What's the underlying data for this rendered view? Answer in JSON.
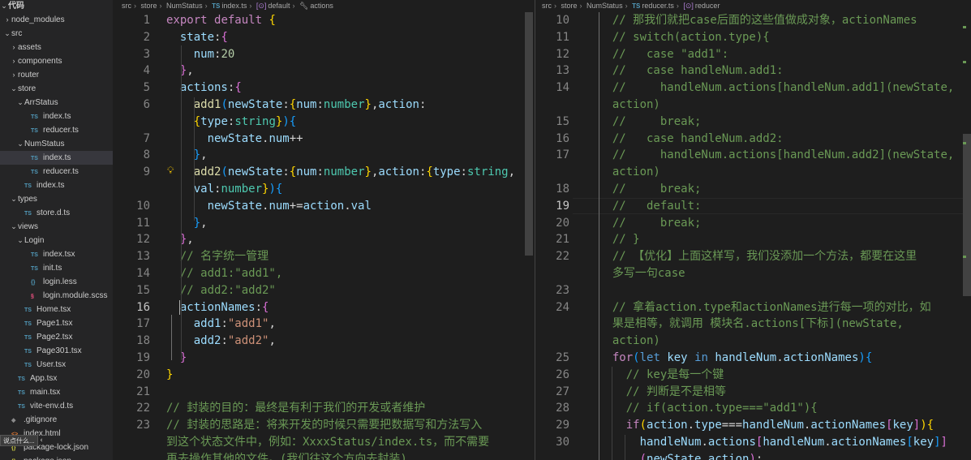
{
  "explorer": {
    "root": "代码",
    "items": [
      {
        "label": "node_modules",
        "icon": "",
        "chev": "›",
        "indent": 1
      },
      {
        "label": "src",
        "icon": "",
        "chev": "⌄",
        "indent": 1
      },
      {
        "label": "assets",
        "icon": "",
        "chev": "›",
        "indent": 2
      },
      {
        "label": "components",
        "icon": "",
        "chev": "›",
        "indent": 2
      },
      {
        "label": "router",
        "icon": "",
        "chev": "›",
        "indent": 2
      },
      {
        "label": "store",
        "icon": "",
        "chev": "⌄",
        "indent": 2
      },
      {
        "label": "ArrStatus",
        "icon": "",
        "chev": "⌄",
        "indent": 3
      },
      {
        "label": "index.ts",
        "icon": "TS",
        "chev": "",
        "indent": 4
      },
      {
        "label": "reducer.ts",
        "icon": "TS",
        "chev": "",
        "indent": 4
      },
      {
        "label": "NumStatus",
        "icon": "",
        "chev": "⌄",
        "indent": 3
      },
      {
        "label": "index.ts",
        "icon": "TS",
        "chev": "",
        "indent": 4
      },
      {
        "label": "reducer.ts",
        "icon": "TS",
        "chev": "",
        "indent": 4
      },
      {
        "label": "index.ts",
        "icon": "TS",
        "chev": "",
        "indent": 3
      },
      {
        "label": "types",
        "icon": "",
        "chev": "⌄",
        "indent": 2
      },
      {
        "label": "store.d.ts",
        "icon": "TS",
        "chev": "",
        "indent": 3
      },
      {
        "label": "views",
        "icon": "",
        "chev": "⌄",
        "indent": 2
      },
      {
        "label": "Login",
        "icon": "",
        "chev": "⌄",
        "indent": 3
      },
      {
        "label": "index.tsx",
        "icon": "TS",
        "chev": "",
        "indent": 4
      },
      {
        "label": "init.ts",
        "icon": "TS",
        "chev": "",
        "indent": 4
      },
      {
        "label": "login.less",
        "icon": "{}",
        "chev": "",
        "indent": 4
      },
      {
        "label": "login.module.scss",
        "icon": "§",
        "chev": "",
        "indent": 4
      },
      {
        "label": "Home.tsx",
        "icon": "TS",
        "chev": "",
        "indent": 3
      },
      {
        "label": "Page1.tsx",
        "icon": "TS",
        "chev": "",
        "indent": 3
      },
      {
        "label": "Page2.tsx",
        "icon": "TS",
        "chev": "",
        "indent": 3
      },
      {
        "label": "Page301.tsx",
        "icon": "TS",
        "chev": "",
        "indent": 3
      },
      {
        "label": "User.tsx",
        "icon": "TS",
        "chev": "",
        "indent": 3
      },
      {
        "label": "App.tsx",
        "icon": "TS",
        "chev": "",
        "indent": 2
      },
      {
        "label": "main.tsx",
        "icon": "TS",
        "chev": "",
        "indent": 2
      },
      {
        "label": "vite-env.d.ts",
        "icon": "TS",
        "chev": "",
        "indent": 2
      },
      {
        "label": ".gitignore",
        "icon": "◆",
        "chev": "",
        "indent": 1
      },
      {
        "label": "index.html",
        "icon": "<>",
        "chev": "",
        "indent": 1
      },
      {
        "label": "package-lock.json",
        "icon": "{}",
        "chev": "",
        "indent": 1
      },
      {
        "label": "package.json",
        "icon": "{}",
        "chev": "",
        "indent": 1
      }
    ],
    "tooltip": "说点什么..."
  },
  "left_editor": {
    "breadcrumb": {
      "parts": [
        "src",
        "store",
        "NumStatus"
      ],
      "file_badge": "TS",
      "file": "index.ts",
      "symbol1": "default",
      "symbol2": "actions"
    },
    "lines": [
      {
        "n": "1",
        "html": "<span class=\"kc\">export</span> <span class=\"kc\">default</span> <span class=\"br1\">{</span>"
      },
      {
        "n": "2",
        "html": "  <span class=\"p\">state</span><span class=\"d\">:</span><span class=\"br2\">{</span>"
      },
      {
        "n": "3",
        "html": "    <span class=\"p\">num</span><span class=\"d\">:</span><span class=\"n\">20</span>"
      },
      {
        "n": "4",
        "html": "  <span class=\"br2\">}</span><span class=\"d\">,</span>"
      },
      {
        "n": "5",
        "html": "  <span class=\"p\">actions</span><span class=\"d\">:</span><span class=\"br2\">{</span>"
      },
      {
        "n": "6",
        "html": "    <span class=\"f\">add1</span><span class=\"br3\">(</span><span class=\"p\">newState</span><span class=\"d\">:</span><span class=\"br1\">{</span><span class=\"p\">num</span><span class=\"d\">:</span><span class=\"t\">number</span><span class=\"br1\">}</span><span class=\"d\">,</span><span class=\"p\">action</span><span class=\"d\">:</span>"
      },
      {
        "n": "",
        "html": "    <span class=\"br1\">{</span><span class=\"p\">type</span><span class=\"d\">:</span><span class=\"t\">string</span><span class=\"br1\">}</span><span class=\"br3\">)</span><span class=\"br3\">{</span>"
      },
      {
        "n": "7",
        "html": "      <span class=\"p\">newState</span><span class=\"d\">.</span><span class=\"p\">num</span><span class=\"d\">++</span>"
      },
      {
        "n": "8",
        "html": "    <span class=\"br3\">}</span><span class=\"d\">,</span>"
      },
      {
        "n": "9",
        "html": "    <span class=\"f\">add2</span><span class=\"br3\">(</span><span class=\"p\">newState</span><span class=\"d\">:</span><span class=\"br1\">{</span><span class=\"p\">num</span><span class=\"d\">:</span><span class=\"t\">number</span><span class=\"br1\">}</span><span class=\"d\">,</span><span class=\"p\">action</span><span class=\"d\">:</span><span class=\"br1\">{</span><span class=\"p\">type</span><span class=\"d\">:</span><span class=\"t\">string</span><span class=\"d\">,</span>"
      },
      {
        "n": "",
        "html": "    <span class=\"p\">val</span><span class=\"d\">:</span><span class=\"t\">number</span><span class=\"br1\">}</span><span class=\"br3\">)</span><span class=\"br3\">{</span>"
      },
      {
        "n": "10",
        "html": "      <span class=\"p\">newState</span><span class=\"d\">.</span><span class=\"p\">num</span><span class=\"d\">+=</span><span class=\"p\">action</span><span class=\"d\">.</span><span class=\"p\">val</span>"
      },
      {
        "n": "11",
        "html": "    <span class=\"br3\">}</span><span class=\"d\">,</span>"
      },
      {
        "n": "12",
        "html": "  <span class=\"br2\">}</span><span class=\"d\">,</span>"
      },
      {
        "n": "13",
        "html": "  <span class=\"c\">// 名字统一管理</span>"
      },
      {
        "n": "14",
        "html": "  <span class=\"c\">// add1:\"add1\",</span>"
      },
      {
        "n": "15",
        "html": "  <span class=\"c\">// add2:\"add2\"</span>"
      },
      {
        "n": "16",
        "html": "  <span class=\"p\">actionNames</span><span class=\"d\">:</span><span class=\"br2\">{</span>"
      },
      {
        "n": "17",
        "html": "    <span class=\"p\">add1</span><span class=\"d\">:</span><span class=\"s\">\"add1\"</span><span class=\"d\">,</span>"
      },
      {
        "n": "18",
        "html": "    <span class=\"p\">add2</span><span class=\"d\">:</span><span class=\"s\">\"add2\"</span><span class=\"d\">,</span>"
      },
      {
        "n": "19",
        "html": "  <span class=\"br2\">}</span>"
      },
      {
        "n": "20",
        "html": "<span class=\"br1\">}</span>"
      },
      {
        "n": "21",
        "html": ""
      },
      {
        "n": "22",
        "html": "<span class=\"c\">// 封装的目的：最终是有利于我们的开发或者维护</span>"
      },
      {
        "n": "23",
        "html": "<span class=\"c\">// 封装的思路是：将来开发的时候只需要把数据写和方法写入</span>"
      },
      {
        "n": "",
        "html": "<span class=\"c\">到这个状态文件中，例如：XxxxStatus/index.ts，而不需要</span>"
      },
      {
        "n": "",
        "html": "<span class=\"c\">再去操作其他的文件。(我们往这个方向去封装)</span>"
      }
    ]
  },
  "right_editor": {
    "breadcrumb": {
      "parts": [
        "src",
        "store",
        "NumStatus"
      ],
      "file_badge": "TS",
      "file": "reducer.ts",
      "symbol1": "reducer"
    },
    "lines": [
      {
        "n": "10",
        "html": "  <span class=\"c\">// 那我们就把case后面的这些值做成对象，actionNames</span>"
      },
      {
        "n": "11",
        "html": "  <span class=\"c\">// switch(action.type){</span>"
      },
      {
        "n": "12",
        "html": "  <span class=\"c\">//   case \"add1\":</span>"
      },
      {
        "n": "13",
        "html": "  <span class=\"c\">//   case handleNum.add1:</span>"
      },
      {
        "n": "14",
        "html": "  <span class=\"c\">//     handleNum.actions[handleNum.add1](newState,</span>"
      },
      {
        "n": "",
        "html": "  <span class=\"c\">action)</span>"
      },
      {
        "n": "15",
        "html": "  <span class=\"c\">//     break;</span>"
      },
      {
        "n": "16",
        "html": "  <span class=\"c\">//   case handleNum.add2:</span>"
      },
      {
        "n": "17",
        "html": "  <span class=\"c\">//     handleNum.actions[handleNum.add2](newState,</span>"
      },
      {
        "n": "",
        "html": "  <span class=\"c\">action)</span>"
      },
      {
        "n": "18",
        "html": "  <span class=\"c\">//     break;</span>"
      },
      {
        "n": "19",
        "html": "  <span class=\"c\">//   default:</span>"
      },
      {
        "n": "20",
        "html": "  <span class=\"c\">//     break;</span>"
      },
      {
        "n": "21",
        "html": "  <span class=\"c\">// }</span>"
      },
      {
        "n": "22",
        "html": "  <span class=\"c\">// 【优化】上面这样写，我们没添加一个方法，都要在这里</span>"
      },
      {
        "n": "",
        "html": "  <span class=\"c\">多写一句case</span>"
      },
      {
        "n": "23",
        "html": ""
      },
      {
        "n": "24",
        "html": "  <span class=\"c\">// 拿着action.type和actionNames进行每一项的对比，如</span>"
      },
      {
        "n": "",
        "html": "  <span class=\"c\">果是相等，就调用 模块名.actions[下标](newState,</span>"
      },
      {
        "n": "",
        "html": "  <span class=\"c\">action)</span>"
      },
      {
        "n": "25",
        "html": "  <span class=\"kc\">for</span><span class=\"br3\">(</span><span class=\"k\">let</span> <span class=\"p\">key</span> <span class=\"k\">in</span> <span class=\"p\">handleNum</span><span class=\"d\">.</span><span class=\"p\">actionNames</span><span class=\"br3\">)</span><span class=\"br3\">{</span>"
      },
      {
        "n": "26",
        "html": "    <span class=\"c\">// key是每一个键</span>"
      },
      {
        "n": "27",
        "html": "    <span class=\"c\">// 判断是不是相等</span>"
      },
      {
        "n": "28",
        "html": "    <span class=\"c\">// if(action.type===\"add1\"){</span>"
      },
      {
        "n": "29",
        "html": "    <span class=\"kc\">if</span><span class=\"br1\">(</span><span class=\"p\">action</span><span class=\"d\">.</span><span class=\"p\">type</span><span class=\"d\">===</span><span class=\"p\">handleNum</span><span class=\"d\">.</span><span class=\"p\">actionNames</span><span class=\"br2\">[</span><span class=\"p\">key</span><span class=\"br2\">]</span><span class=\"br1\">)</span><span class=\"br1\">{</span>"
      },
      {
        "n": "30",
        "html": "      <span class=\"p\">handleNum</span><span class=\"d\">.</span><span class=\"p\">actions</span><span class=\"br2\">[</span><span class=\"p\">handleNum</span><span class=\"d\">.</span><span class=\"p\">actionNames</span><span class=\"br3\">[</span><span class=\"p\">key</span><span class=\"br3\">]</span><span class=\"br2\">]</span>"
      },
      {
        "n": "",
        "html": "      <span class=\"br2\">(</span><span class=\"p\">newState</span><span class=\"d\">,</span><span class=\"p\">action</span><span class=\"br2\">)</span><span class=\"d\">;</span>"
      }
    ]
  }
}
